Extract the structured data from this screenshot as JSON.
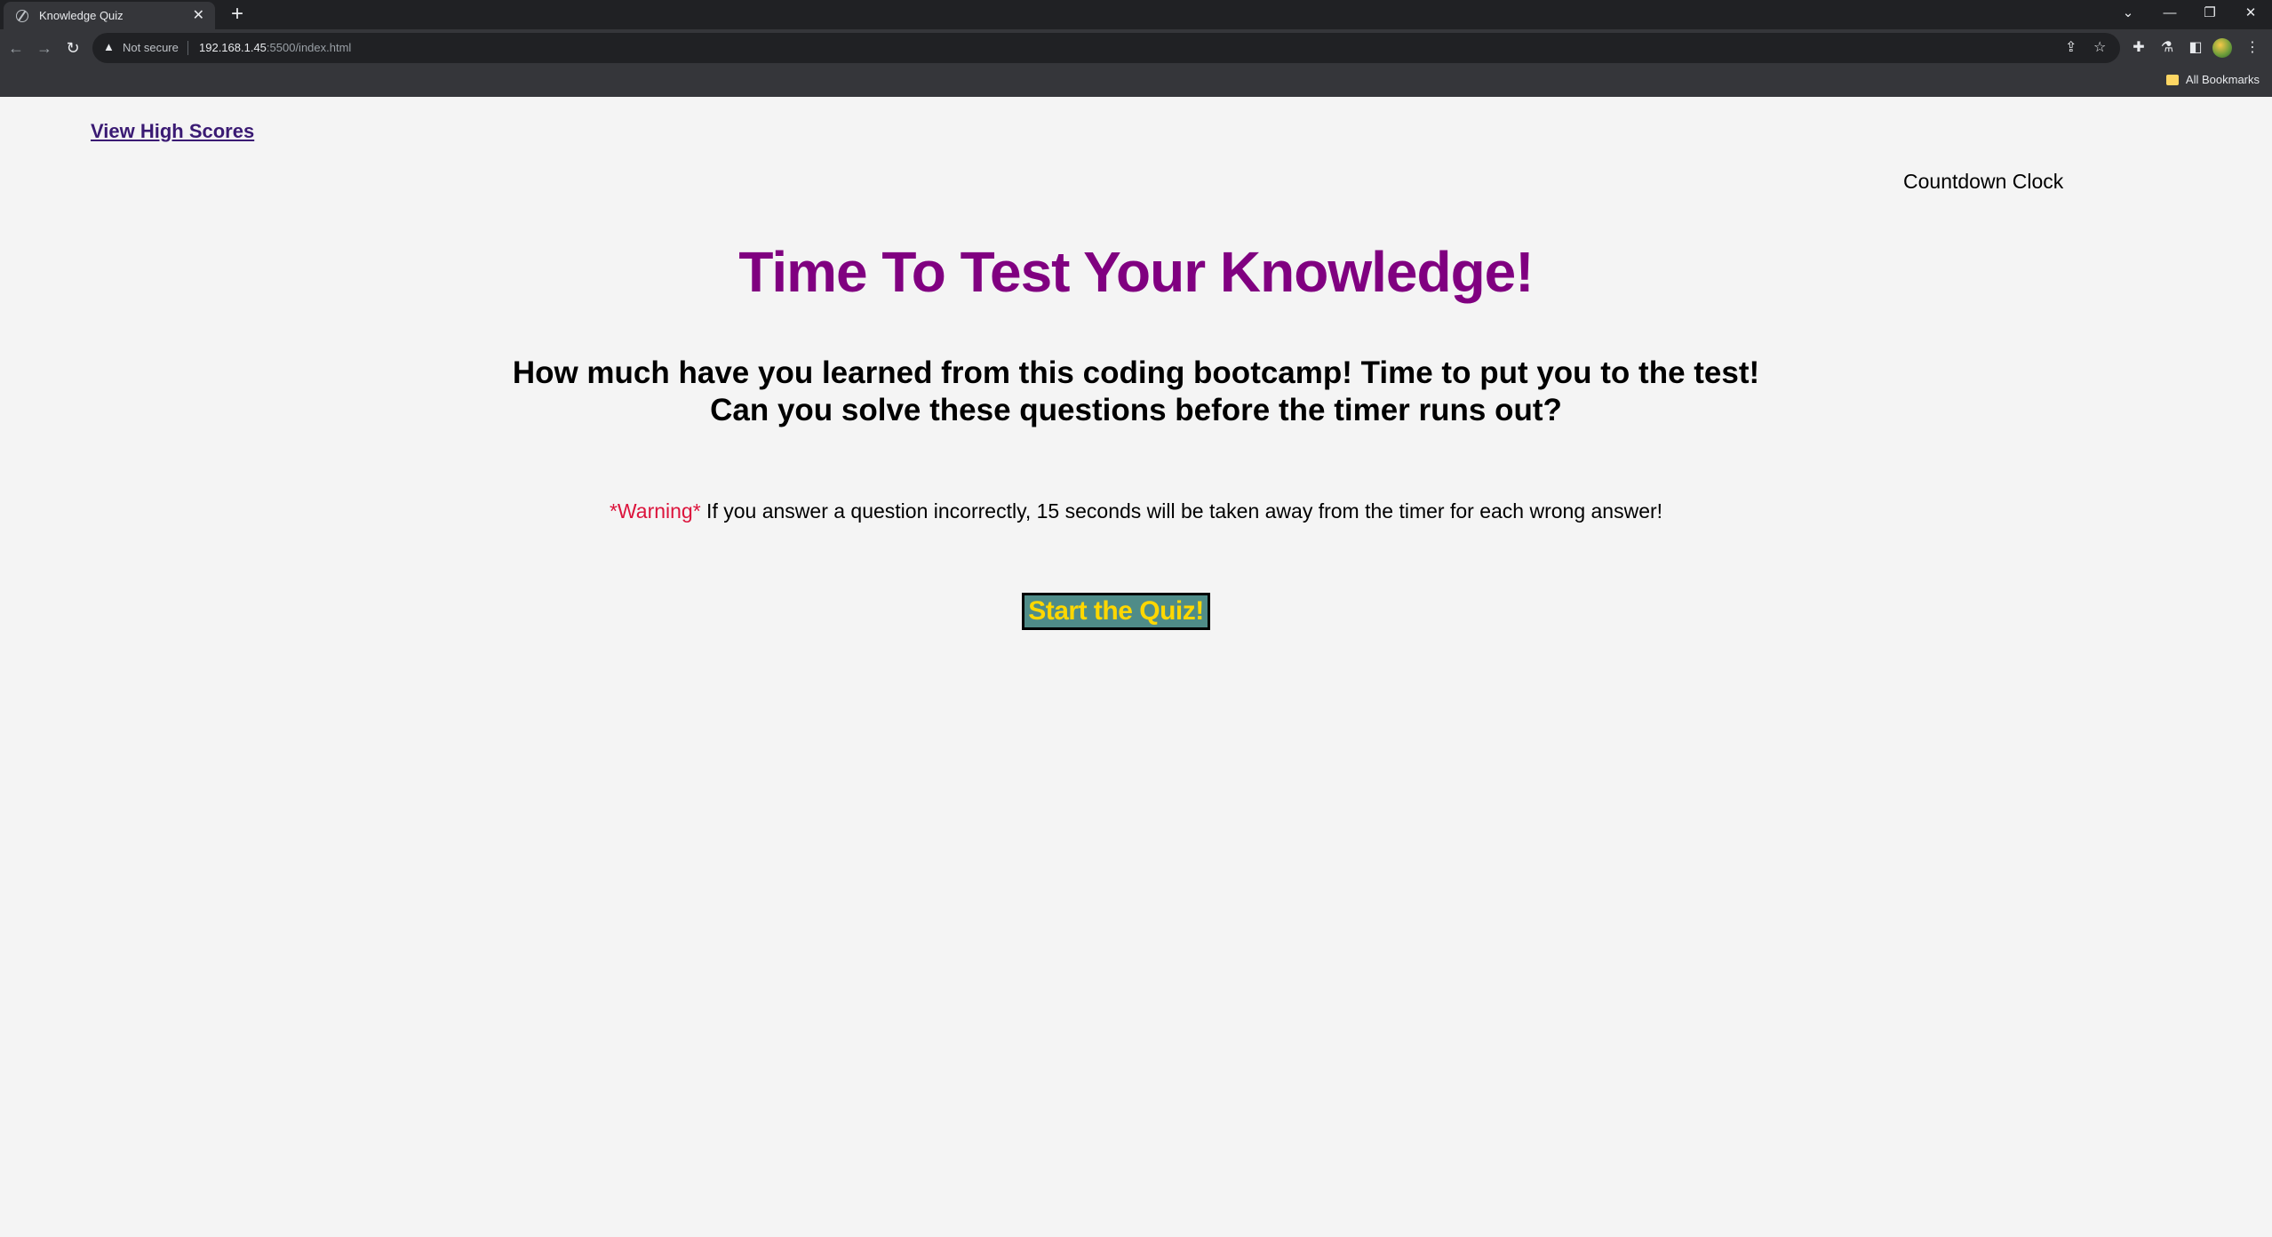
{
  "browser": {
    "tab_title": "Knowledge Quiz",
    "tab_close": "✕",
    "new_tab": "+",
    "not_secure": "Not secure",
    "url_host": "192.168.1.45",
    "url_rest": ":5500/index.html",
    "bookmarks_label": "All Bookmarks",
    "window_controls": {
      "minimize": "—",
      "restore": "❐",
      "close": "✕",
      "tab_search": "⌄"
    }
  },
  "page": {
    "highscores_link": "View High Scores",
    "countdown_label": "Countdown Clock",
    "title": "Time To Test Your Knowledge!",
    "subtitle_line1": "How much have you learned from this coding bootcamp! Time to put you to the test!",
    "subtitle_line2": "Can you solve these questions before the timer runs out?",
    "warning_tag": "*Warning*",
    "warning_text": " If you answer a question incorrectly, 15 seconds will be taken away from the timer for each wrong answer!",
    "start_button": "Start the Quiz!"
  },
  "colors": {
    "title": "#800080",
    "warning_tag": "#dc143c",
    "button_bg": "#4f8c88",
    "button_text": "#ffd700",
    "link": "#3a1a73"
  }
}
